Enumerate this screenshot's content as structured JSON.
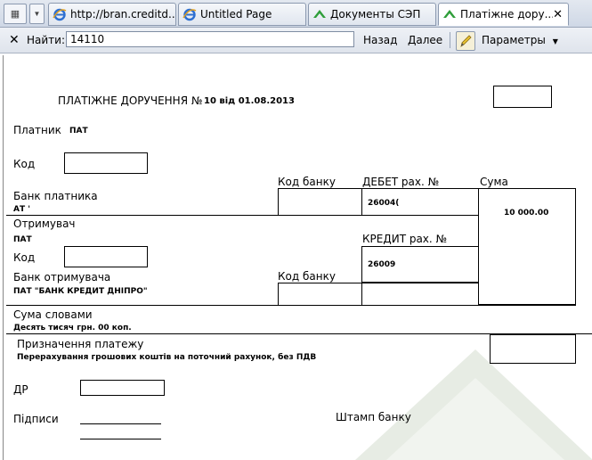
{
  "tabs": [
    {
      "title": "http://bran.creditd...",
      "icon": "ie-icon",
      "active": false
    },
    {
      "title": "Untitled Page",
      "icon": "ie-icon",
      "active": false
    },
    {
      "title": "Документы СЭП",
      "icon": "green-chevron-icon",
      "active": false
    },
    {
      "title": "Платіжне дору...",
      "icon": "green-chevron-icon",
      "active": true
    }
  ],
  "findbar": {
    "close": "✕",
    "label": "Найти:",
    "value": "14110",
    "back": "Назад",
    "next": "Далее",
    "options": "Параметры"
  },
  "doc": {
    "title": "ПЛАТІЖНЕ ДОРУЧЕННЯ №",
    "title_details": "10 від 01.08.2013",
    "payer_label": "Платник",
    "payer_value": "ПАТ",
    "code_label": "Код",
    "bank_code_label": "Код банку",
    "debit_label": "ДЕБЕТ рах. №",
    "sum_label": "Сума",
    "payer_bank_label": "Банк платника",
    "payer_bank_value": "АТ '",
    "debit_account": "26004(",
    "amount": "10 000.00",
    "recipient_label": "Отримувач",
    "recipient_value": "ПАТ",
    "credit_label": "КРЕДИТ рах. №",
    "recipient_code_label": "Код",
    "credit_account": "26009",
    "recipient_bank_label": "Банк отримувача",
    "recipient_bank_code_label": "Код банку",
    "recipient_bank_value": "ПАТ \"БАНК КРЕДИТ ДНІПРО\"",
    "sum_words_label": "Сума словами",
    "sum_words_value": "Десять тисяч грн. 00 коп.",
    "purpose_label": "Призначення платежу",
    "purpose_value": "Перерахування грошових коштів на поточний рахунок, без ПДВ",
    "dr_label": "ДР",
    "signatures_label": "Підписи",
    "stamp_label": "Штамп банку"
  }
}
